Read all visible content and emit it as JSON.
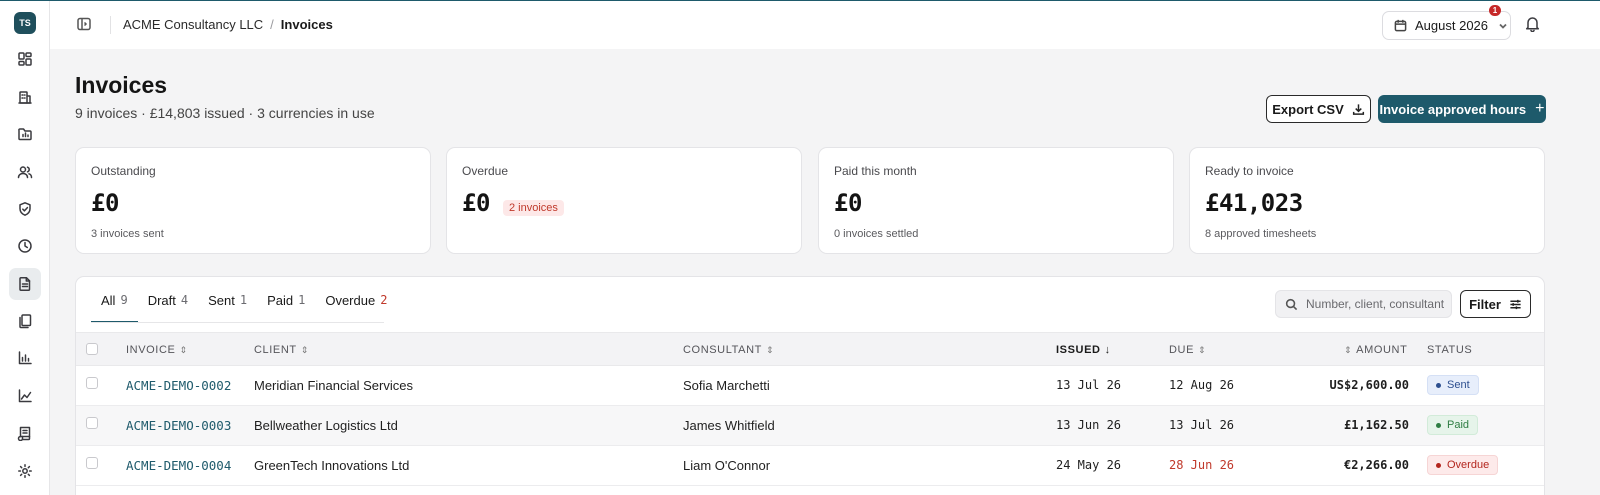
{
  "user": {
    "initials": "TS"
  },
  "header": {
    "org": "ACME Consultancy LLC",
    "separator": "/",
    "current": "Invoices",
    "period": "August 2026",
    "notifications_count": "1"
  },
  "page": {
    "title": "Invoices",
    "subtitle": "9 invoices · £14,803 issued · 3 currencies in use",
    "export_label": "Export CSV",
    "primary_label": "Invoice approved hours",
    "primary_icon": "+"
  },
  "cards": [
    {
      "label": "Outstanding",
      "value": "£0",
      "foot": "3 invoices sent"
    },
    {
      "label": "Overdue",
      "value": "£0",
      "badge": "2 invoices"
    },
    {
      "label": "Paid this month",
      "value": "£0",
      "foot": "0 invoices settled"
    },
    {
      "label": "Ready to invoice",
      "value": "£41,023",
      "foot": "8 approved timesheets"
    }
  ],
  "tabs": [
    {
      "label": "All",
      "count": "9"
    },
    {
      "label": "Draft",
      "count": "4"
    },
    {
      "label": "Sent",
      "count": "1"
    },
    {
      "label": "Paid",
      "count": "1"
    },
    {
      "label": "Overdue",
      "count": "2"
    }
  ],
  "search": {
    "placeholder": "Number, client, consultant"
  },
  "filter_label": "Filter",
  "table": {
    "columns": {
      "invoice": "INVOICE",
      "client": "CLIENT",
      "consultant": "CONSULTANT",
      "issued": "ISSUED",
      "due": "DUE",
      "amount": "AMOUNT",
      "status": "STATUS"
    },
    "sort_asc_desc": "⇕",
    "sort_down": "↓",
    "rows": [
      {
        "invoice": "ACME-DEMO-0002",
        "client": "Meridian Financial Services",
        "consultant": "Sofia Marchetti",
        "issued": "13 Jul 26",
        "due": "12 Aug 26",
        "amount": "US$2,600.00",
        "status": "Sent"
      },
      {
        "invoice": "ACME-DEMO-0003",
        "client": "Bellweather Logistics Ltd",
        "consultant": "James Whitfield",
        "issued": "13 Jun 26",
        "due": "13 Jul 26",
        "amount": "£1,162.50",
        "status": "Paid"
      },
      {
        "invoice": "ACME-DEMO-0004",
        "client": "GreenTech Innovations Ltd",
        "consultant": "Liam O'Connor",
        "issued": "24 May 26",
        "due": "28 Jun 26",
        "amount": "€2,266.00",
        "status": "Overdue"
      }
    ]
  },
  "colors": {
    "accent": "#1e5a6b",
    "danger": "#c0392b",
    "paid": "#2e7d43",
    "sent": "#2d4f8f"
  },
  "sidebar_icons": [
    "dashboard-icon",
    "building-icon",
    "folder-icon",
    "users-icon",
    "shield-icon",
    "clock-icon",
    "invoice-icon",
    "documents-icon",
    "bar-chart-icon",
    "line-chart-icon",
    "ledger-icon",
    "settings-icon"
  ]
}
